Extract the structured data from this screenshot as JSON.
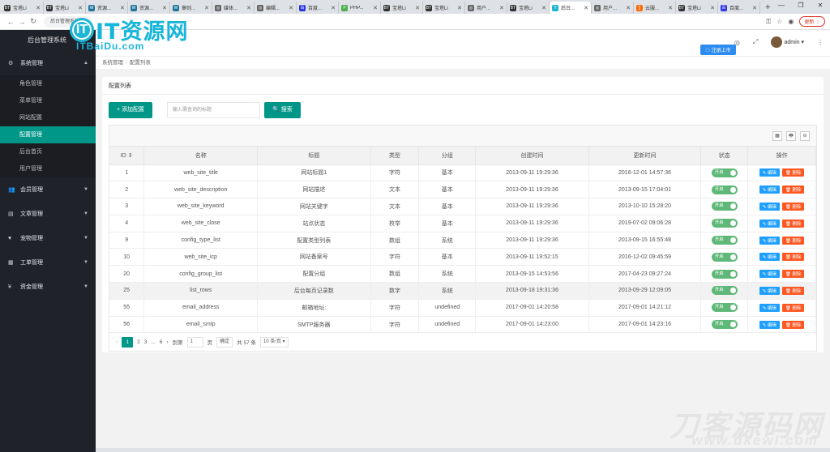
{
  "browser": {
    "tabs": [
      {
        "label": "宝塔Li",
        "fav": "BT",
        "color": "#333"
      },
      {
        "label": "宝塔Li",
        "fav": "BT",
        "color": "#333"
      },
      {
        "label": "资源...",
        "fav": "W",
        "color": "#21759b"
      },
      {
        "label": "资源...",
        "fav": "W",
        "color": "#21759b"
      },
      {
        "label": "章则...",
        "fav": "W",
        "color": "#21759b"
      },
      {
        "label": "媒体...",
        "fav": "◎",
        "color": "#666"
      },
      {
        "label": "编辑...",
        "fav": "◎",
        "color": "#666"
      },
      {
        "label": "百度...",
        "fav": "百",
        "color": "#2932e1"
      },
      {
        "label": "PHP...",
        "fav": "P",
        "color": "#4caf50"
      },
      {
        "label": "宝塔Li",
        "fav": "BT",
        "color": "#333"
      },
      {
        "label": "宝塔Li",
        "fav": "BT",
        "color": "#333"
      },
      {
        "label": "用户...",
        "fav": "◎",
        "color": "#666"
      },
      {
        "label": "宝塔Li",
        "fav": "BT",
        "color": "#333"
      },
      {
        "label": "后台...",
        "fav": "Y",
        "color": "#1fb6d6",
        "active": true
      },
      {
        "label": "用户...",
        "fav": "◎",
        "color": "#666"
      },
      {
        "label": "云服...",
        "fav": "[]",
        "color": "#ff6a00"
      },
      {
        "label": "宝塔Li",
        "fav": "BT",
        "color": "#333"
      },
      {
        "label": "百度...",
        "fav": "百",
        "color": "#2932e1"
      }
    ],
    "new_tab": "+",
    "win_controls": [
      "—",
      "❐",
      "✕"
    ],
    "address": "后台管理系统",
    "update_label": "更新 ⋮"
  },
  "brand": {
    "circle": "IT",
    "text": "IT资源网",
    "sub": "ITBaiDu.com"
  },
  "sidebar": {
    "logo": "后台管理系统",
    "groups": [
      {
        "label": "系统管理",
        "icon": "gear-icon",
        "glyph": "⚙",
        "caret": "▲"
      },
      {
        "label": "会员管理",
        "icon": "users-icon",
        "glyph": "👥",
        "caret": "▼"
      },
      {
        "label": "文章管理",
        "icon": "article-icon",
        "glyph": "▤",
        "caret": "▼"
      },
      {
        "label": "宠物管理",
        "icon": "heart-icon",
        "glyph": "♥",
        "caret": "▼"
      },
      {
        "label": "工单管理",
        "icon": "ticket-icon",
        "glyph": "▦",
        "caret": "▼"
      },
      {
        "label": "资金管理",
        "icon": "yen-icon",
        "glyph": "¥",
        "caret": "▼"
      }
    ],
    "sub_items": [
      "角色管理",
      "菜单管理",
      "网站配置",
      "配置管理",
      "后台首页",
      "用户管理"
    ],
    "active_sub": 3
  },
  "header": {
    "icons": [
      "◎",
      "⤢"
    ],
    "admin": "admin ▾",
    "more": "⋮",
    "cloud_badge": "☁ 注册上市"
  },
  "breadcrumb": {
    "items": [
      "系统管理",
      "配置列表"
    ],
    "sep": "/"
  },
  "card": {
    "title": "配置列表",
    "add_button": "+ 添加配置",
    "search_placeholder": "输入需查询的标题",
    "search_button": "🔍 搜索",
    "tools": [
      "▦",
      "🖶",
      "⊖"
    ]
  },
  "table": {
    "headers": [
      "ID ⇕",
      "名称",
      "标题",
      "类型",
      "分组",
      "创建时间",
      "更新时间",
      "状态",
      "操作"
    ],
    "rows": [
      [
        "1",
        "web_site_title",
        "网站标题1",
        "字符",
        "基本",
        "2013-09-11 19:29:36",
        "2016-12-01 14:57:36"
      ],
      [
        "2",
        "web_site_description",
        "网站描述",
        "文本",
        "基本",
        "2013-09-11 19:29:36",
        "2013-09-15 17:04:01"
      ],
      [
        "3",
        "web_site_keyword",
        "网站关键字",
        "文本",
        "基本",
        "2013-09-11 19:29:36",
        "2013-10-10 15:28:20"
      ],
      [
        "4",
        "web_site_close",
        "站点状态",
        "枚举",
        "基本",
        "2013-09-11 19:29:36",
        "2019-07-02 09:06:28"
      ],
      [
        "9",
        "config_type_list",
        "配置类型列表",
        "数组",
        "系统",
        "2013-09-11 19:29:36",
        "2013-09-15 16:55:48"
      ],
      [
        "10",
        "web_site_icp",
        "网站备案号",
        "字符",
        "基本",
        "2013-09-11 19:52:15",
        "2016-12-02 09:45:59"
      ],
      [
        "20",
        "config_group_list",
        "配置分组",
        "数组",
        "系统",
        "2013-09-15 14:53:56",
        "2017-04-23 09:27:24"
      ],
      [
        "25",
        "list_rows",
        "后台每页记录数",
        "数字",
        "系统",
        "2013-09-18 19:31:36",
        "2013-09-29 12:09:05"
      ],
      [
        "55",
        "email_address",
        "邮箱地址:",
        "字符",
        "undefined",
        "2017-09-01 14:20:58",
        "2017-09-01 14:21:12"
      ],
      [
        "56",
        "email_smtp",
        "SMTP服务器",
        "字符",
        "undefined",
        "2017-09-01 14:23:00",
        "2017-09-01 14:23:16"
      ]
    ],
    "highlight_row": 7,
    "status_label": "开启",
    "edit_label": "✎ 编辑",
    "delete_label": "🗑 删除"
  },
  "pager": {
    "prev": "‹",
    "pages": [
      "1",
      "2",
      "3",
      "...",
      "6"
    ],
    "next": "›",
    "goto_label": "到第",
    "goto_value": "1",
    "page_unit": "页",
    "confirm": "确定",
    "total": "共 57 条",
    "per_page": "10 条/页 ▾"
  },
  "watermark": {
    "main": "刀客源码网",
    "sub": "www.dkewl.com"
  }
}
